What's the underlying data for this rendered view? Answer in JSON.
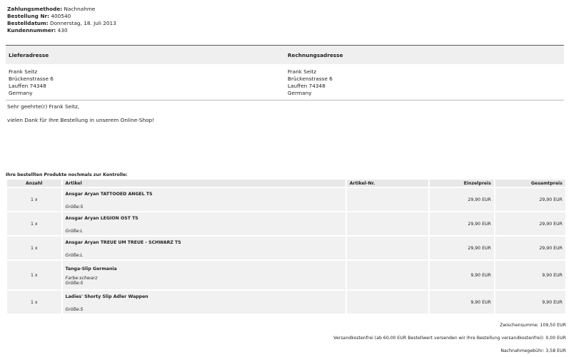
{
  "meta": {
    "payment_label": "Zahlungsmethode:",
    "payment_value": " Nachnahme",
    "order_label": "Bestellung Nr:",
    "order_value": " 400540",
    "date_label": "Bestelldatum:",
    "date_value": " Donnerstag, 18. Juli 2013",
    "customer_label": "Kundennummer:",
    "customer_value": " 430"
  },
  "addresses": {
    "delivery_title": "Lieferadresse",
    "billing_title": "Rechnungsadresse",
    "delivery": [
      "Frank Seitz",
      "Brückenstrasse 6",
      "Lauffen 74348",
      "Germany"
    ],
    "billing": [
      "Frank Seitz",
      "Brückenstrasse 6",
      "Lauffen 74348",
      "Germany"
    ]
  },
  "greeting": "Sehr geehrte(r) Frank Seitz,",
  "thanks": "vielen Dank für Ihre Bestellung in unserem Online-Shop!",
  "products_title": "Ihre bestellten Produkte nochmals zur Kontrolle:",
  "table": {
    "headers": {
      "qty": "Anzahl",
      "article": "Artikel",
      "article_no": "Artikel-Nr.",
      "unit_price": "Einzelpreis",
      "total_price": "Gesamtpreis"
    },
    "rows": [
      {
        "qty": "1 x",
        "name": "Ansgar Aryan TATTOOED ANGEL TS",
        "attr1": "",
        "attr2": "Größe:S",
        "article_no": "",
        "unit": "29,90 EUR",
        "total": "29,90 EUR"
      },
      {
        "qty": "1 x",
        "name": "Ansgar Aryan LEGION OST TS",
        "attr1": "",
        "attr2": "Größe:L",
        "article_no": "",
        "unit": "29,90 EUR",
        "total": "29,90 EUR"
      },
      {
        "qty": "1 x",
        "name": "Ansgar Aryan TREUE UM TREUE - SCHWARZ TS",
        "attr1": "",
        "attr2": "Größe:L",
        "article_no": "",
        "unit": "29,90 EUR",
        "total": "29,90 EUR"
      },
      {
        "qty": "1 x",
        "name": "Tanga-Slip Germania",
        "attr1": "Farbe:schwarz",
        "attr2": "Größe:S",
        "article_no": "",
        "unit": "9,90 EUR",
        "total": "9,90 EUR"
      },
      {
        "qty": "1 x",
        "name": "Ladies' Shorty Slip Adler Wappen",
        "attr1": "",
        "attr2": "Größe:S",
        "article_no": "",
        "unit": "9,90 EUR",
        "total": "9,90 EUR"
      }
    ]
  },
  "totals": {
    "subtotal": "Zwischensumme: 109,50 EUR",
    "shipping": "Versandkostenfrei (ab 60,00 EUR Bestellwert versenden wir Ihre Bestellung versandkostenfrei): 0,00 EUR",
    "cod_fee": "Nachnahmegebühr: 3,58 EUR"
  }
}
